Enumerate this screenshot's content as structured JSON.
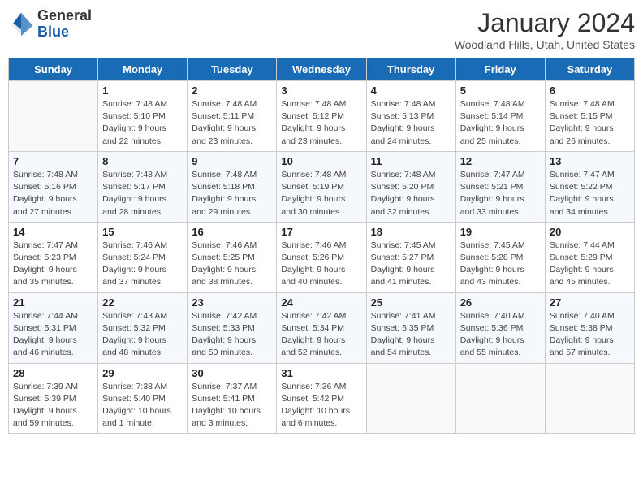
{
  "header": {
    "logo_general": "General",
    "logo_blue": "Blue",
    "month_title": "January 2024",
    "location": "Woodland Hills, Utah, United States"
  },
  "days_of_week": [
    "Sunday",
    "Monday",
    "Tuesday",
    "Wednesday",
    "Thursday",
    "Friday",
    "Saturday"
  ],
  "weeks": [
    [
      {
        "day": "",
        "sunrise": "",
        "sunset": "",
        "daylight": ""
      },
      {
        "day": "1",
        "sunrise": "Sunrise: 7:48 AM",
        "sunset": "Sunset: 5:10 PM",
        "daylight": "Daylight: 9 hours and 22 minutes."
      },
      {
        "day": "2",
        "sunrise": "Sunrise: 7:48 AM",
        "sunset": "Sunset: 5:11 PM",
        "daylight": "Daylight: 9 hours and 23 minutes."
      },
      {
        "day": "3",
        "sunrise": "Sunrise: 7:48 AM",
        "sunset": "Sunset: 5:12 PM",
        "daylight": "Daylight: 9 hours and 23 minutes."
      },
      {
        "day": "4",
        "sunrise": "Sunrise: 7:48 AM",
        "sunset": "Sunset: 5:13 PM",
        "daylight": "Daylight: 9 hours and 24 minutes."
      },
      {
        "day": "5",
        "sunrise": "Sunrise: 7:48 AM",
        "sunset": "Sunset: 5:14 PM",
        "daylight": "Daylight: 9 hours and 25 minutes."
      },
      {
        "day": "6",
        "sunrise": "Sunrise: 7:48 AM",
        "sunset": "Sunset: 5:15 PM",
        "daylight": "Daylight: 9 hours and 26 minutes."
      }
    ],
    [
      {
        "day": "7",
        "sunrise": "",
        "sunset": "",
        "daylight": ""
      },
      {
        "day": "8",
        "sunrise": "Sunrise: 7:48 AM",
        "sunset": "Sunset: 5:17 PM",
        "daylight": "Daylight: 9 hours and 28 minutes."
      },
      {
        "day": "9",
        "sunrise": "Sunrise: 7:48 AM",
        "sunset": "Sunset: 5:18 PM",
        "daylight": "Daylight: 9 hours and 29 minutes."
      },
      {
        "day": "10",
        "sunrise": "Sunrise: 7:48 AM",
        "sunset": "Sunset: 5:19 PM",
        "daylight": "Daylight: 9 hours and 30 minutes."
      },
      {
        "day": "11",
        "sunrise": "Sunrise: 7:48 AM",
        "sunset": "Sunset: 5:20 PM",
        "daylight": "Daylight: 9 hours and 32 minutes."
      },
      {
        "day": "12",
        "sunrise": "Sunrise: 7:47 AM",
        "sunset": "Sunset: 5:21 PM",
        "daylight": "Daylight: 9 hours and 33 minutes."
      },
      {
        "day": "13",
        "sunrise": "Sunrise: 7:47 AM",
        "sunset": "Sunset: 5:22 PM",
        "daylight": "Daylight: 9 hours and 34 minutes."
      }
    ],
    [
      {
        "day": "14",
        "sunrise": "Sunrise: 7:47 AM",
        "sunset": "Sunset: 5:23 PM",
        "daylight": "Daylight: 9 hours and 35 minutes."
      },
      {
        "day": "15",
        "sunrise": "Sunrise: 7:46 AM",
        "sunset": "Sunset: 5:24 PM",
        "daylight": "Daylight: 9 hours and 37 minutes."
      },
      {
        "day": "16",
        "sunrise": "Sunrise: 7:46 AM",
        "sunset": "Sunset: 5:25 PM",
        "daylight": "Daylight: 9 hours and 38 minutes."
      },
      {
        "day": "17",
        "sunrise": "Sunrise: 7:46 AM",
        "sunset": "Sunset: 5:26 PM",
        "daylight": "Daylight: 9 hours and 40 minutes."
      },
      {
        "day": "18",
        "sunrise": "Sunrise: 7:45 AM",
        "sunset": "Sunset: 5:27 PM",
        "daylight": "Daylight: 9 hours and 41 minutes."
      },
      {
        "day": "19",
        "sunrise": "Sunrise: 7:45 AM",
        "sunset": "Sunset: 5:28 PM",
        "daylight": "Daylight: 9 hours and 43 minutes."
      },
      {
        "day": "20",
        "sunrise": "Sunrise: 7:44 AM",
        "sunset": "Sunset: 5:29 PM",
        "daylight": "Daylight: 9 hours and 45 minutes."
      }
    ],
    [
      {
        "day": "21",
        "sunrise": "Sunrise: 7:44 AM",
        "sunset": "Sunset: 5:31 PM",
        "daylight": "Daylight: 9 hours and 46 minutes."
      },
      {
        "day": "22",
        "sunrise": "Sunrise: 7:43 AM",
        "sunset": "Sunset: 5:32 PM",
        "daylight": "Daylight: 9 hours and 48 minutes."
      },
      {
        "day": "23",
        "sunrise": "Sunrise: 7:42 AM",
        "sunset": "Sunset: 5:33 PM",
        "daylight": "Daylight: 9 hours and 50 minutes."
      },
      {
        "day": "24",
        "sunrise": "Sunrise: 7:42 AM",
        "sunset": "Sunset: 5:34 PM",
        "daylight": "Daylight: 9 hours and 52 minutes."
      },
      {
        "day": "25",
        "sunrise": "Sunrise: 7:41 AM",
        "sunset": "Sunset: 5:35 PM",
        "daylight": "Daylight: 9 hours and 54 minutes."
      },
      {
        "day": "26",
        "sunrise": "Sunrise: 7:40 AM",
        "sunset": "Sunset: 5:36 PM",
        "daylight": "Daylight: 9 hours and 55 minutes."
      },
      {
        "day": "27",
        "sunrise": "Sunrise: 7:40 AM",
        "sunset": "Sunset: 5:38 PM",
        "daylight": "Daylight: 9 hours and 57 minutes."
      }
    ],
    [
      {
        "day": "28",
        "sunrise": "Sunrise: 7:39 AM",
        "sunset": "Sunset: 5:39 PM",
        "daylight": "Daylight: 9 hours and 59 minutes."
      },
      {
        "day": "29",
        "sunrise": "Sunrise: 7:38 AM",
        "sunset": "Sunset: 5:40 PM",
        "daylight": "Daylight: 10 hours and 1 minute."
      },
      {
        "day": "30",
        "sunrise": "Sunrise: 7:37 AM",
        "sunset": "Sunset: 5:41 PM",
        "daylight": "Daylight: 10 hours and 3 minutes."
      },
      {
        "day": "31",
        "sunrise": "Sunrise: 7:36 AM",
        "sunset": "Sunset: 5:42 PM",
        "daylight": "Daylight: 10 hours and 6 minutes."
      },
      {
        "day": "",
        "sunrise": "",
        "sunset": "",
        "daylight": ""
      },
      {
        "day": "",
        "sunrise": "",
        "sunset": "",
        "daylight": ""
      },
      {
        "day": "",
        "sunrise": "",
        "sunset": "",
        "daylight": ""
      }
    ]
  ],
  "week1_sun": {
    "sunrise": "Sunrise: 7:48 AM",
    "sunset": "Sunset: 5:16 PM",
    "daylight": "Daylight: 9 hours and 27 minutes."
  }
}
